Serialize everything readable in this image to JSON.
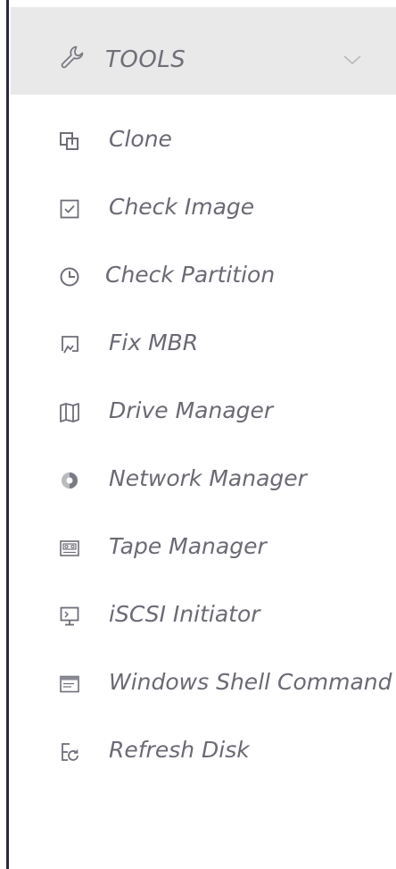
{
  "tools_section": {
    "title": "TOOLS",
    "header_icon": "wrench-icon",
    "expand_icon": "chevron-down-icon",
    "items": [
      {
        "label": "Clone",
        "icon": "clone-icon"
      },
      {
        "label": "Check Image",
        "icon": "checkbox-icon"
      },
      {
        "label": "Check Partition",
        "icon": "clock-icon"
      },
      {
        "label": "Fix MBR",
        "icon": "fix-mbr-icon"
      },
      {
        "label": "Drive Manager",
        "icon": "map-icon"
      },
      {
        "label": "Network Manager",
        "icon": "network-icon"
      },
      {
        "label": "Tape Manager",
        "icon": "tape-icon"
      },
      {
        "label": "iSCSI Initiator",
        "icon": "monitor-icon"
      },
      {
        "label": "Windows Shell Command",
        "icon": "window-icon"
      },
      {
        "label": "Refresh Disk",
        "icon": "refresh-disk-icon"
      }
    ]
  },
  "colors": {
    "header_background": "#e9e9ea",
    "text": "#6a6a74",
    "icon": "#7a7a84",
    "left_border": "#2b2740"
  }
}
